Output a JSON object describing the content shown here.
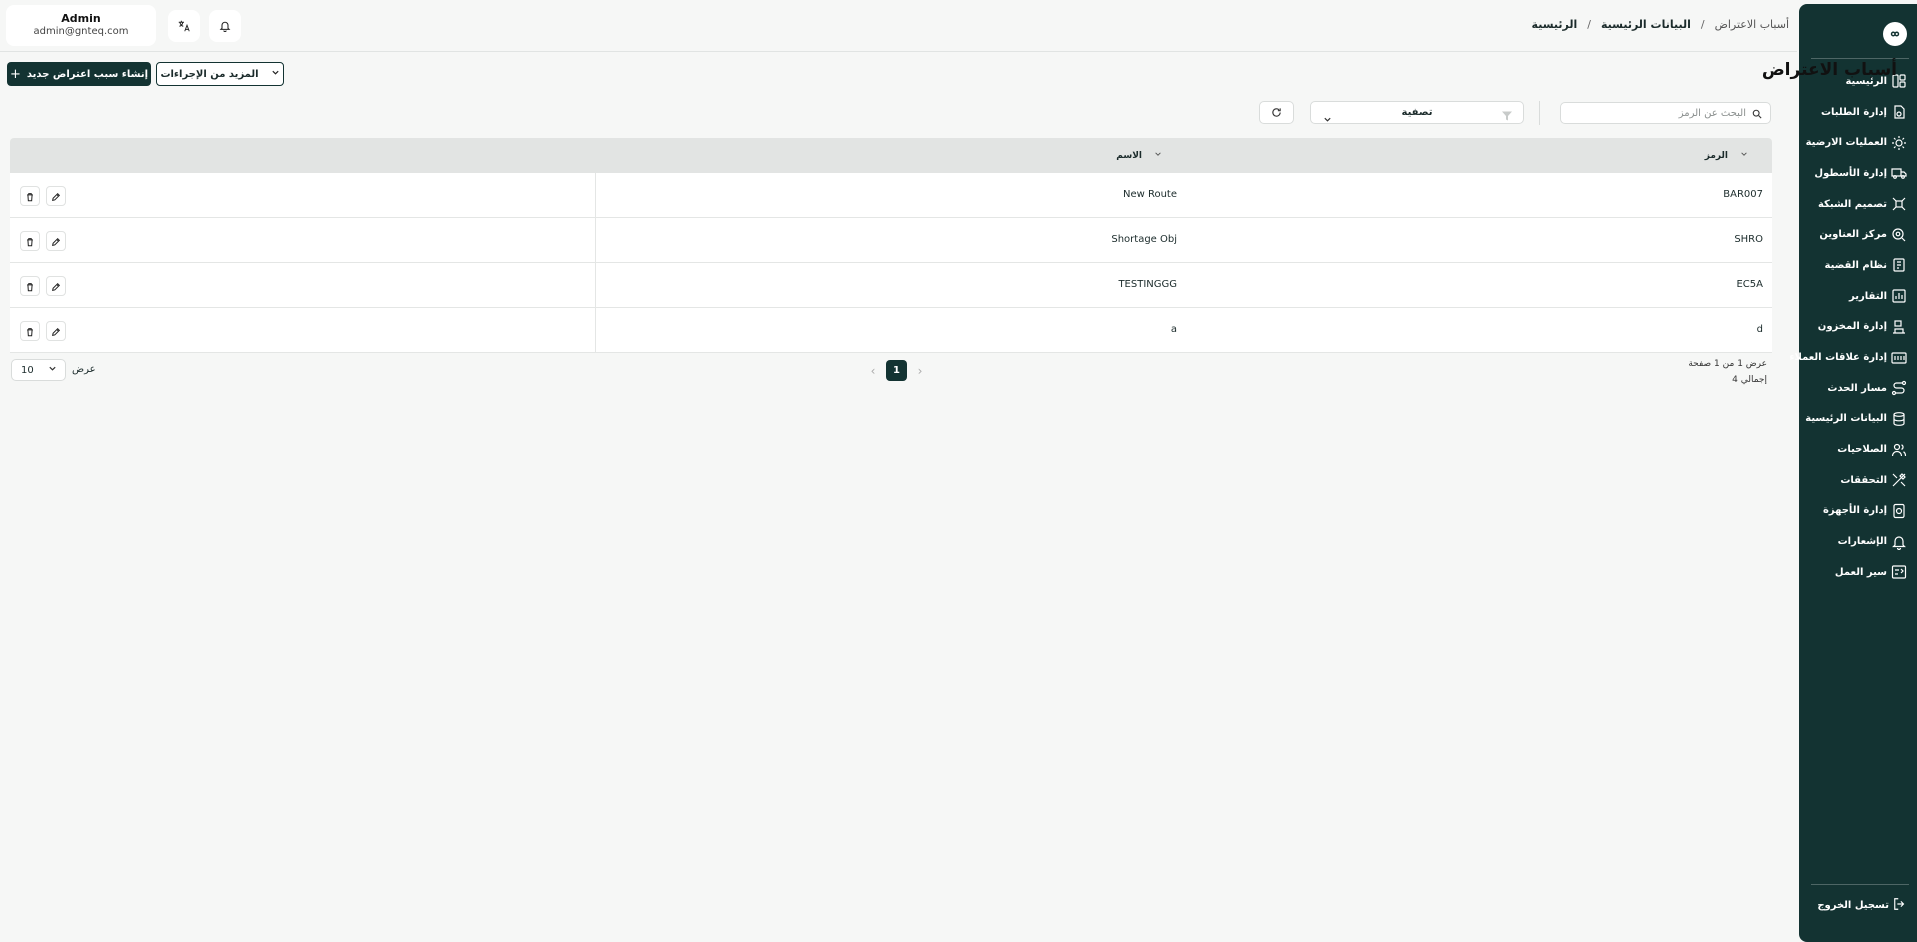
{
  "user": {
    "name": "Admin",
    "email": "admin@gnteq.com"
  },
  "breadcrumb": {
    "home": "الرئيسية",
    "master_data": "البيانات الرئيسية",
    "current": "أسباب الاعتراض",
    "sep": "/"
  },
  "page": {
    "title": "أسباب الاعتراض",
    "create_label": "إنشاء سبب اعتراض جديد",
    "more_label": "المزيد من الإجراءات"
  },
  "toolbar": {
    "search_placeholder": "البحث عن الرمز",
    "filter_label": "تصفية"
  },
  "sidebar": {
    "items": [
      {
        "label": "الرئيسية",
        "icon": "dashboard-icon"
      },
      {
        "label": "إدارة الطلبات",
        "icon": "orders-icon"
      },
      {
        "label": "العمليات الارضية",
        "icon": "ground-ops-icon"
      },
      {
        "label": "إدارة الأسطول",
        "icon": "truck-icon"
      },
      {
        "label": "تصميم الشبكة",
        "icon": "network-icon"
      },
      {
        "label": "مركز العناوين",
        "icon": "location-icon"
      },
      {
        "label": "نظام القضية",
        "icon": "case-icon"
      },
      {
        "label": "التقارير",
        "icon": "reports-icon"
      },
      {
        "label": "إدارة المخزون",
        "icon": "inventory-icon"
      },
      {
        "label": "إدارة علاقات العملاء",
        "icon": "crm-icon"
      },
      {
        "label": "مسار الحدث",
        "icon": "route-icon"
      },
      {
        "label": "البيانات الرئيسية",
        "icon": "database-icon"
      },
      {
        "label": "الصلاحيات",
        "icon": "users-icon"
      },
      {
        "label": "التحققات",
        "icon": "tools-icon"
      },
      {
        "label": "إدارة الأجهزة",
        "icon": "device-icon"
      },
      {
        "label": "الإشعارات",
        "icon": "bell-icon"
      },
      {
        "label": "سير العمل",
        "icon": "workflow-icon"
      }
    ],
    "logout_label": "تسجيل الخروج"
  },
  "table": {
    "columns": {
      "code": "الرمز",
      "name": "الاسم"
    },
    "rows": [
      {
        "code": "BAR007",
        "name": "New Route"
      },
      {
        "code": "SHRO",
        "name": "Shortage Obj"
      },
      {
        "code": "EC5A",
        "name": "TESTINGGG"
      },
      {
        "code": "d",
        "name": "a"
      }
    ]
  },
  "pagination": {
    "info": "عرض 1 من 1 صفحة",
    "total": "إجمالي 4",
    "current_page": "1",
    "show_label": "عرض",
    "page_size": "10"
  },
  "colors": {
    "primary": "#133332",
    "background": "#f6f7f6",
    "header_row": "#e2e4e3"
  }
}
